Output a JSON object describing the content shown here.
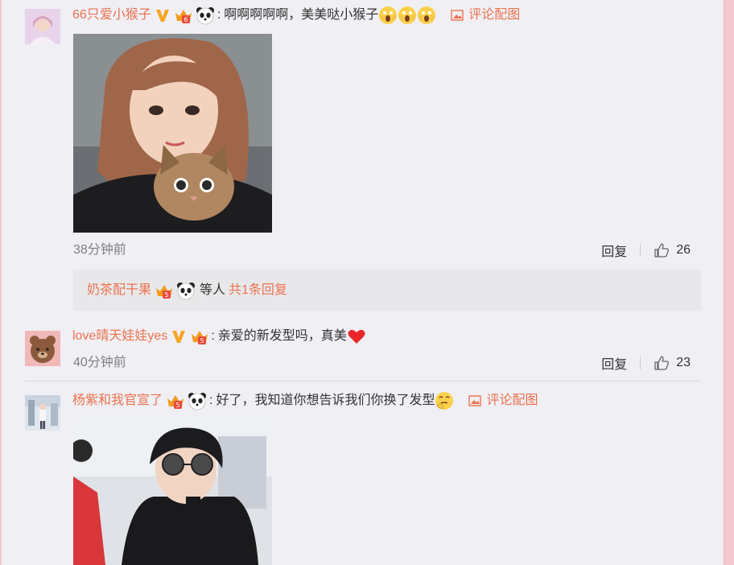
{
  "comments": [
    {
      "user": "66只爱小猴子",
      "text": "啊啊啊啊啊，美美哒小猴子",
      "pic_link": "评论配图",
      "time": "38分钟前",
      "reply": "回复",
      "likes": "26",
      "sub": {
        "user": "奶茶配干果",
        "suffix": "等人",
        "more": "共1条回复"
      }
    },
    {
      "user": "love晴天娃娃yes",
      "text": "亲爱的新发型吗，真美",
      "time": "40分钟前",
      "reply": "回复",
      "likes": "23"
    },
    {
      "user": "杨紫和我官宣了",
      "text": "好了，我知道你想告诉我们你换了发型",
      "pic_link": "评论配图"
    }
  ],
  "colors": {
    "accent": "#eb7350",
    "background": "#f0eff4",
    "subbox": "#e8e8ea",
    "frame": "#f4c9cf"
  },
  "icons": [
    "verified-v-icon",
    "vip-crown-icon",
    "panda-icon",
    "shocked-emoji-icon",
    "heart-emoji-icon",
    "thinking-emoji-icon",
    "image-icon",
    "thumbs-up-icon"
  ]
}
